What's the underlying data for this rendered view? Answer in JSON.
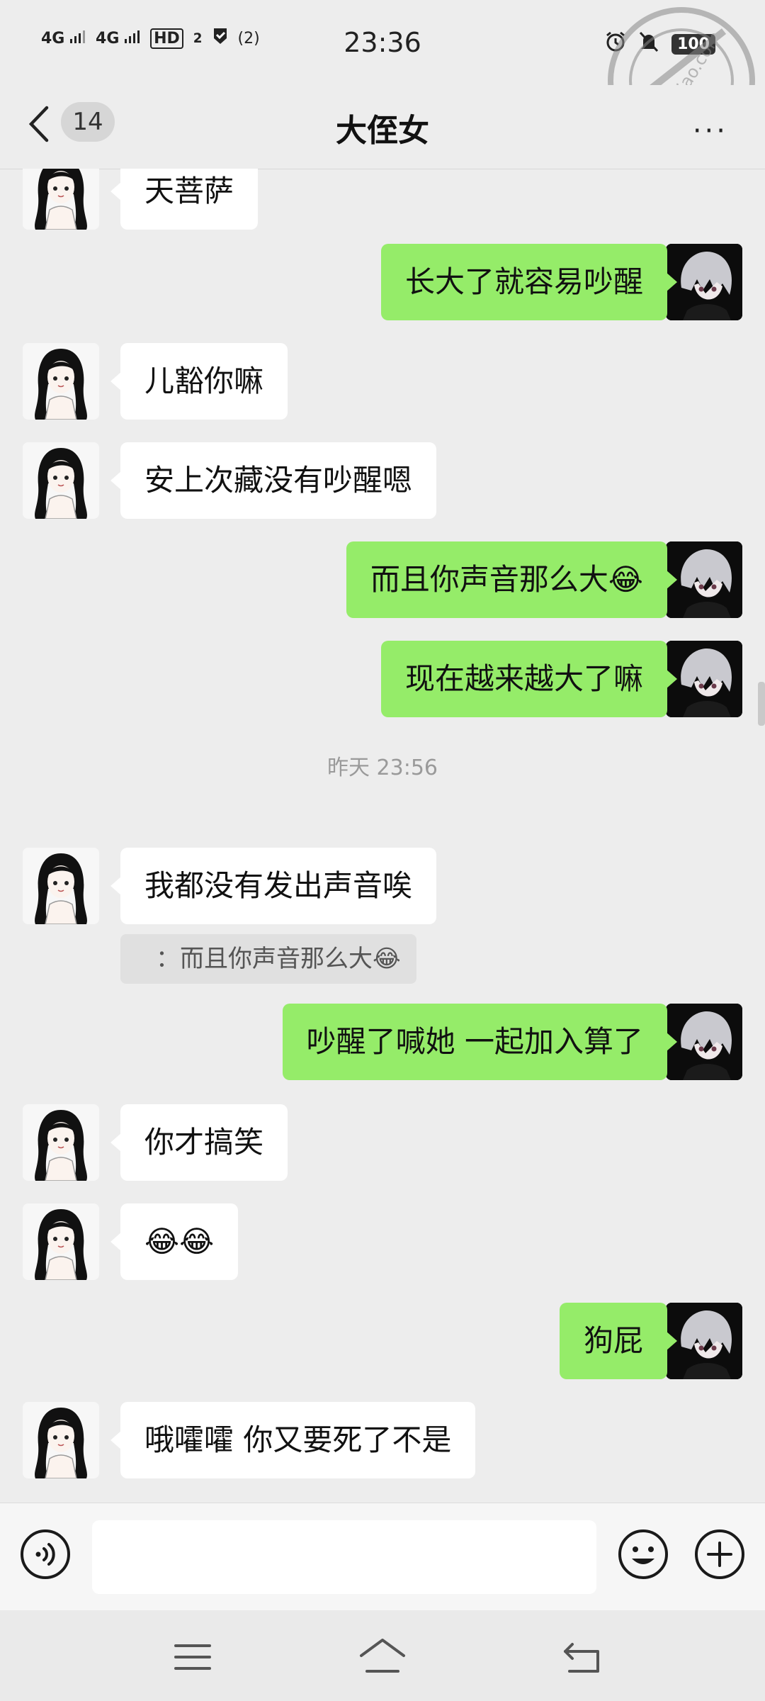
{
  "status_bar": {
    "signal_1": "4G",
    "signal_2": "4G",
    "hd": "HD",
    "hd_sub": "2",
    "hotspot": "(2)",
    "time": "23:36",
    "battery": "100"
  },
  "header": {
    "unread_count": "14",
    "title": "大侄女",
    "more": "···"
  },
  "watermark": {
    "text": "hajiao.com"
  },
  "messages": [
    {
      "side": "left",
      "text": "天菩萨"
    },
    {
      "side": "right",
      "text": "长大了就容易吵醒"
    },
    {
      "side": "left",
      "text": "儿豁你嘛"
    },
    {
      "side": "left",
      "text": "安上次藏没有吵醒嗯"
    },
    {
      "side": "right",
      "text": "而且你声音那么大😂"
    },
    {
      "side": "right",
      "text": "现在越来越大了嘛"
    },
    {
      "timestamp": "昨天 23:56"
    },
    {
      "side": "left",
      "text": "我都没有发出声音唉",
      "quote": "：而且你声音那么大😂"
    },
    {
      "side": "right",
      "text": "吵醒了喊她 一起加入算了"
    },
    {
      "side": "left",
      "text": "你才搞笑"
    },
    {
      "side": "left",
      "text": "😂😂"
    },
    {
      "side": "right",
      "text": "狗屁"
    },
    {
      "side": "left",
      "text": "哦嚯嚯   你又要死了不是"
    }
  ],
  "input_bar": {
    "voice_icon": "voice-icon",
    "emoji_icon": "emoji-icon",
    "plus_icon": "plus-icon",
    "input_value": ""
  },
  "colors": {
    "background": "#ededed",
    "bubble_self": "#95ec69",
    "bubble_other": "#ffffff"
  }
}
